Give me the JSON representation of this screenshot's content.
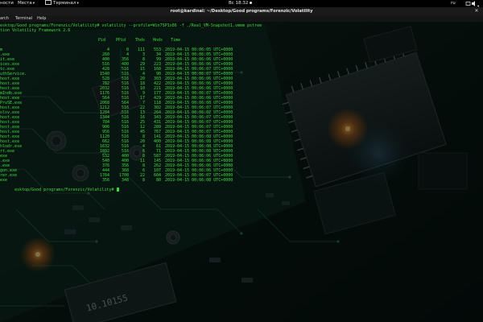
{
  "top_panel": {
    "activities": "ности",
    "places": "Места",
    "app_name": "Терминал",
    "clock": "Вс 18:32",
    "keyboard_layout": "ru"
  },
  "terminal": {
    "title": "root@kardinal: ~/Desktop/Good programs/Forenzic/Volatility",
    "menu": [
      "arch",
      "Terminal",
      "Help"
    ],
    "command_line": "esktop/Good programs/Forenzic/Volatility# volatility --profile=Win7SP1x86 -f ./Real_VM-Snapshot1.vmem pstree",
    "banner": "tion Volatility Framework 2.6",
    "headers": {
      "pid": "Pid",
      "ppid": "PPid",
      "thds": "Thds",
      "hnds": "Hnds",
      "time": "Time"
    },
    "rows": [
      {
        "name": "m",
        "pid": "4",
        "ppid": "0",
        "thds": "111",
        "hnds": "553",
        "time": "2019-04-15 00:06:05 UTC+0000"
      },
      {
        "name": ".exe",
        "pid": "260",
        "ppid": "4",
        "thds": "3",
        "hnds": "34",
        "time": "2019-04-15 00:06:05 UTC+0000"
      },
      {
        "name": "it.exe",
        "pid": "400",
        "ppid": "356",
        "thds": "8",
        "hnds": "99",
        "time": "2019-04-15 00:06:06 UTC+0000"
      },
      {
        "name": "ices.exe",
        "pid": "516",
        "ppid": "400",
        "thds": "29",
        "hnds": "223",
        "time": "2019-04-15 00:06:06 UTC+0000"
      },
      {
        "name": "tc.exe",
        "pid": "428",
        "ppid": "516",
        "thds": "15",
        "hnds": "160",
        "time": "2019-04-15 00:06:07 UTC+0000"
      },
      {
        "name": "uthService.",
        "pid": "1540",
        "ppid": "516",
        "thds": "4",
        "hnds": "90",
        "time": "2019-04-15 00:06:07 UTC+0000"
      },
      {
        "name": "host.exe",
        "pid": "528",
        "ppid": "516",
        "thds": "20",
        "hnds": "303",
        "time": "2019-04-15 00:06:06 UTC+0000"
      },
      {
        "name": "host.exe",
        "pid": "782",
        "ppid": "516",
        "thds": "18",
        "hnds": "422",
        "time": "2019-04-15 00:06:06 UTC+0000"
      },
      {
        "name": "host.exe",
        "pid": "2032",
        "ppid": "516",
        "thds": "10",
        "hnds": "221",
        "time": "2019-04-15 00:06:06 UTC+0000"
      },
      {
        "name": "mIndb.exe",
        "pid": "1176",
        "ppid": "516",
        "thds": "9",
        "hnds": "177",
        "time": "2019-04-15 00:06:07 UTC+0000"
      },
      {
        "name": "host.exe",
        "pid": "564",
        "ppid": "516",
        "thds": "17",
        "hnds": "429",
        "time": "2019-04-15 00:06:06 UTC+0000"
      },
      {
        "name": "PrvSE.exe",
        "pid": "2068",
        "ppid": "564",
        "thds": "7",
        "hnds": "118",
        "time": "2019-04-15 00:06:08 UTC+0000"
      },
      {
        "name": "host.exe",
        "pid": "1212",
        "ppid": "516",
        "thds": "22",
        "hnds": "302",
        "time": "2019-04-15 00:06:07 UTC+0000"
      },
      {
        "name": "olsv.exe",
        "pid": "1284",
        "ppid": "516",
        "thds": "13",
        "hnds": "264",
        "time": "2019-04-15 00:06:07 UTC+0000"
      },
      {
        "name": "host.exe",
        "pid": "1344",
        "ppid": "516",
        "thds": "16",
        "hnds": "343",
        "time": "2019-04-15 00:06:07 UTC+0000"
      },
      {
        "name": "host.exe",
        "pid": "784",
        "ppid": "516",
        "thds": "25",
        "hnds": "431",
        "time": "2019-04-15 00:06:07 UTC+0000"
      },
      {
        "name": "host.exe",
        "pid": "906",
        "ppid": "516",
        "thds": "12",
        "hnds": "289",
        "time": "2019-04-15 00:06:07 UTC+0000"
      },
      {
        "name": "host.exe",
        "pid": "956",
        "ppid": "516",
        "thds": "45",
        "hnds": "767",
        "time": "2019-04-15 00:06:07 UTC+0000"
      },
      {
        "name": "host.exe",
        "pid": "1120",
        "ppid": "516",
        "thds": "8",
        "hnds": "141",
        "time": "2019-04-15 00:06:08 UTC+0000"
      },
      {
        "name": "host.exe",
        "pid": "662",
        "ppid": "516",
        "thds": "20",
        "hnds": "400",
        "time": "2019-04-15 00:06:08 UTC+0000"
      },
      {
        "name": "hlodr.exe",
        "pid": "1632",
        "ppid": "516",
        "thds": "4",
        "hnds": "61",
        "time": "2019-04-15 00:06:08 UTC+0000"
      },
      {
        "name": "rt.exe",
        "pid": "1892",
        "ppid": "516",
        "thds": "6",
        "hnds": "71",
        "time": "2019-04-15 00:06:08 UTC+0000"
      },
      {
        "name": "exe",
        "pid": "532",
        "ppid": "400",
        "thds": "8",
        "hnds": "587",
        "time": "2019-04-15 00:06:06 UTC+0000"
      },
      {
        "name": ".exe",
        "pid": "540",
        "ppid": "400",
        "thds": "11",
        "hnds": "145",
        "time": "2019-04-15 00:06:06 UTC+0000"
      },
      {
        "name": ".exe",
        "pid": "376",
        "ppid": "356",
        "thds": "8",
        "hnds": "262",
        "time": "2019-04-15 00:06:06 UTC+0000"
      },
      {
        "name": "gon.exe",
        "pid": "444",
        "ppid": "368",
        "thds": "6",
        "hnds": "107",
        "time": "2019-04-15 00:06:06 UTC+0000"
      },
      {
        "name": "rer.exe",
        "pid": "1764",
        "ppid": "1708",
        "thds": "22",
        "hnds": "604",
        "time": "2019-04-15 00:06:07 UTC+0000"
      },
      {
        "name": "exe",
        "pid": "356",
        "ppid": "348",
        "thds": "8",
        "hnds": "80",
        "time": "2019-04-15 00:06:08 UTC+0000"
      }
    ],
    "prompt_line": "esktop/Good programs/Forenzic/Volatility#"
  },
  "wallpaper": {
    "chip_label": "10.10155"
  }
}
